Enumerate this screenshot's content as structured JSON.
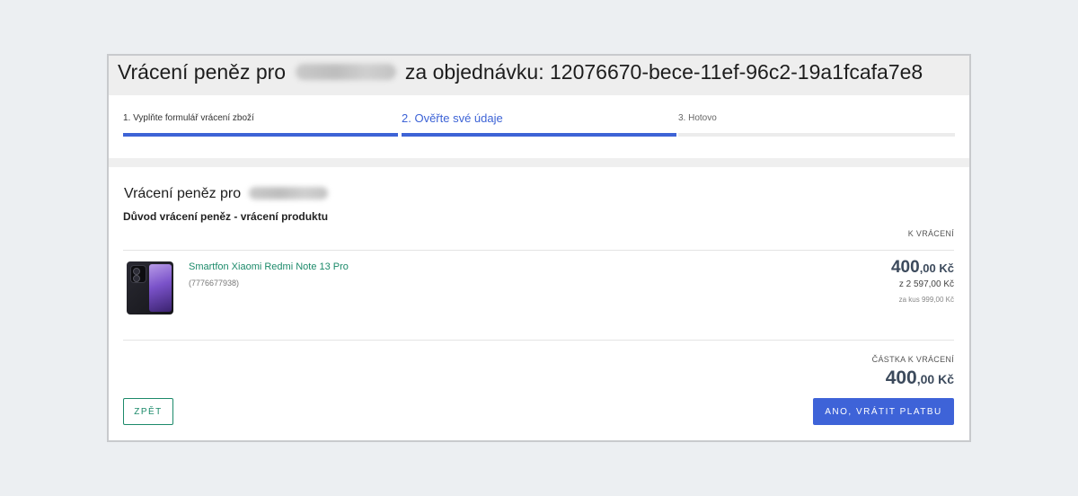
{
  "header": {
    "title_prefix": "Vrácení peněz pro",
    "title_mid": "za objednávku:",
    "order_id": "12076670-bece-11ef-96c2-19a1fcafa7e8"
  },
  "steps": [
    {
      "label": "1. Vyplňte formulář vrácení zboží",
      "state": "done"
    },
    {
      "label": "2. Ověřte své údaje",
      "state": "active"
    },
    {
      "label": "3. Hotovo",
      "state": "pending"
    }
  ],
  "refund": {
    "title": "Vrácení peněz pro",
    "reason": "Důvod vrácení peněz - vrácení produktu",
    "column_header": "K VRÁCENÍ"
  },
  "product": {
    "name": "Smartfon Xiaomi Redmi Note 13 Pro",
    "code": "(7776677938)",
    "image_icon": "smartphone-image",
    "amount_main": "400",
    "amount_cents": ",00 Kč",
    "of_total": "z 2 597,00 Kč",
    "per_piece": "za kus 999,00 Kč"
  },
  "total": {
    "label": "ČÁSTKA K VRÁCENÍ",
    "amount_main": "400",
    "amount_cents": ",00 Kč"
  },
  "buttons": {
    "back_label": "ZPĚT",
    "confirm_label": "ANO, VRÁTIT PLATBU"
  },
  "colors": {
    "accent_blue": "#3e63d8",
    "link_green": "#1c8a6a",
    "amount_slate": "#3c4a5c"
  }
}
